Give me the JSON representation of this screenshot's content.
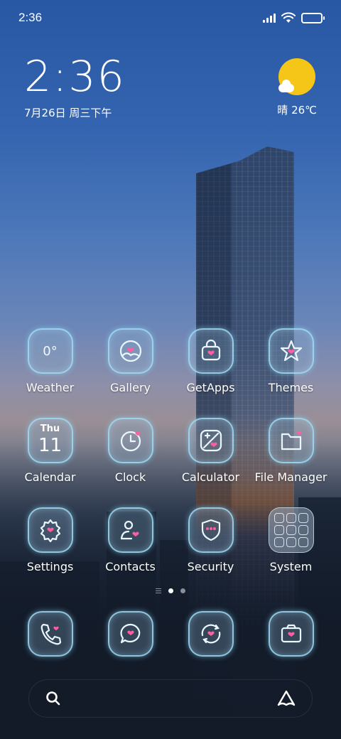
{
  "status_bar": {
    "time": "2:36",
    "battery_level": 0.95
  },
  "clock_widget": {
    "time": "2:36",
    "date": "7月26日 周三下午"
  },
  "weather_widget": {
    "text": "晴 26℃",
    "icon": "sun-cloud-icon"
  },
  "apps": [
    {
      "label": "Weather",
      "icon": "weather-icon",
      "icon_text": "0°"
    },
    {
      "label": "Gallery",
      "icon": "gallery-icon"
    },
    {
      "label": "GetApps",
      "icon": "getapps-bag-icon"
    },
    {
      "label": "Themes",
      "icon": "themes-star-icon"
    },
    {
      "label": "Calendar",
      "icon": "calendar-icon",
      "day": "Thu",
      "date": "11"
    },
    {
      "label": "Clock",
      "icon": "clock-icon"
    },
    {
      "label": "Calculator",
      "icon": "calculator-icon"
    },
    {
      "label": "File Manager",
      "icon": "folder-icon"
    },
    {
      "label": "Settings",
      "icon": "settings-gear-icon"
    },
    {
      "label": "Contacts",
      "icon": "contacts-icon"
    },
    {
      "label": "Security",
      "icon": "security-shield-icon"
    },
    {
      "label": "System",
      "icon": "system-folder-icon"
    }
  ],
  "dock": [
    {
      "icon": "phone-icon"
    },
    {
      "icon": "messages-icon"
    },
    {
      "icon": "browser-icon"
    },
    {
      "icon": "camera-icon"
    }
  ],
  "page_indicator": {
    "pages": 2,
    "current": 1
  },
  "colors": {
    "neon": "#a0dcf5",
    "heart": "#ff5fa2",
    "sun": "#f5c518"
  }
}
